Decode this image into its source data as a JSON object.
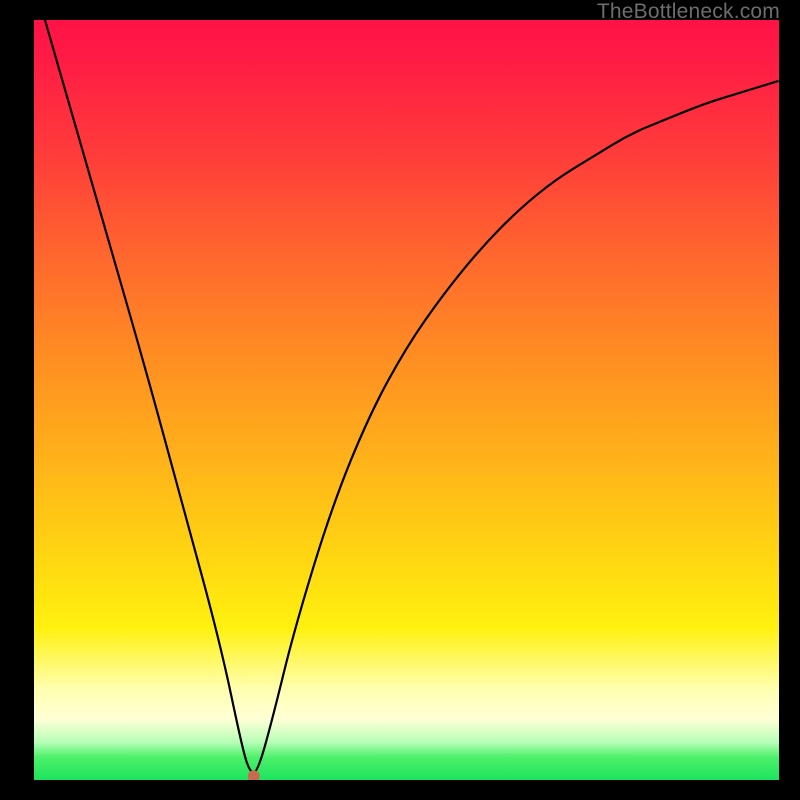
{
  "watermark": "TheBottleneck.com",
  "chart_data": {
    "type": "line",
    "title": "",
    "xlabel": "",
    "ylabel": "",
    "xlim": [
      0,
      100
    ],
    "ylim": [
      0,
      100
    ],
    "grid": false,
    "legend": false,
    "series": [
      {
        "name": "curve",
        "color": "#000000",
        "x": [
          0,
          5,
          10,
          15,
          20,
          25,
          28,
          29,
          30,
          32,
          35,
          40,
          45,
          50,
          55,
          60,
          65,
          70,
          75,
          80,
          85,
          90,
          95,
          100
        ],
        "y": [
          105,
          88,
          71,
          54,
          36,
          18,
          4,
          1,
          1,
          8,
          20,
          36,
          48,
          57,
          64,
          70,
          75,
          79,
          82,
          85,
          87,
          89,
          90.5,
          92
        ]
      }
    ],
    "marker": {
      "x": 29.5,
      "y": 0.5,
      "color": "#c86a4d",
      "radius_px": 6
    },
    "background_gradient_axis": "y",
    "background_gradient_stops": [
      {
        "t": 0.0,
        "color": "#1de45e"
      },
      {
        "t": 0.05,
        "color": "#b8ffb8"
      },
      {
        "t": 0.12,
        "color": "#ffffb0"
      },
      {
        "t": 0.2,
        "color": "#fff10f"
      },
      {
        "t": 0.42,
        "color": "#ffb31a"
      },
      {
        "t": 0.68,
        "color": "#ff6a2d"
      },
      {
        "t": 1.0,
        "color": "#ff1247"
      }
    ]
  }
}
